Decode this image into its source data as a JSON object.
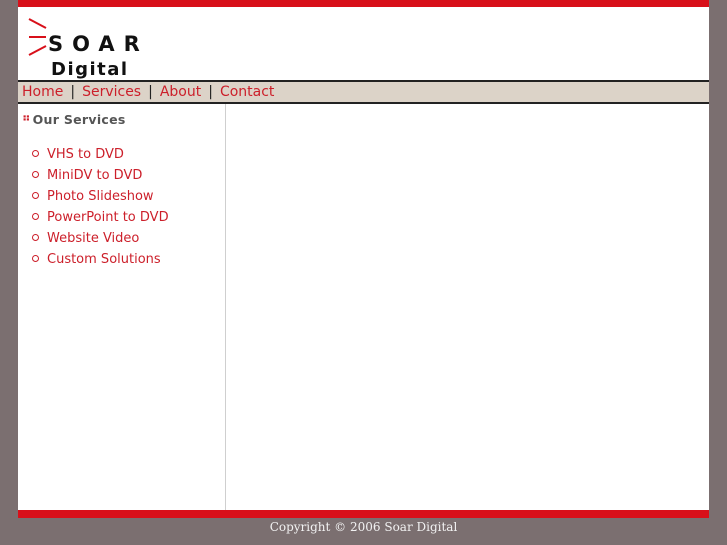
{
  "logo": {
    "word1": "SOAR",
    "word2": "Digital",
    "accent_color": "#d8101a"
  },
  "nav": {
    "items": [
      {
        "label": "Home"
      },
      {
        "label": "Services"
      },
      {
        "label": "About"
      },
      {
        "label": "Contact"
      }
    ],
    "separator": "|"
  },
  "sidebar": {
    "title": "Our Services",
    "items": [
      {
        "label": "VHS to DVD"
      },
      {
        "label": "MiniDV to DVD"
      },
      {
        "label": "Photo Slideshow"
      },
      {
        "label": "PowerPoint to DVD"
      },
      {
        "label": "Website Video"
      },
      {
        "label": "Custom Solutions"
      }
    ]
  },
  "footer": {
    "copyright": "Copyright © 2006 Soar Digital"
  },
  "colors": {
    "link": "#cc1f2a",
    "bar": "#d8101a",
    "background": "#7b6f70",
    "nav_bg": "#dcd3c8"
  }
}
